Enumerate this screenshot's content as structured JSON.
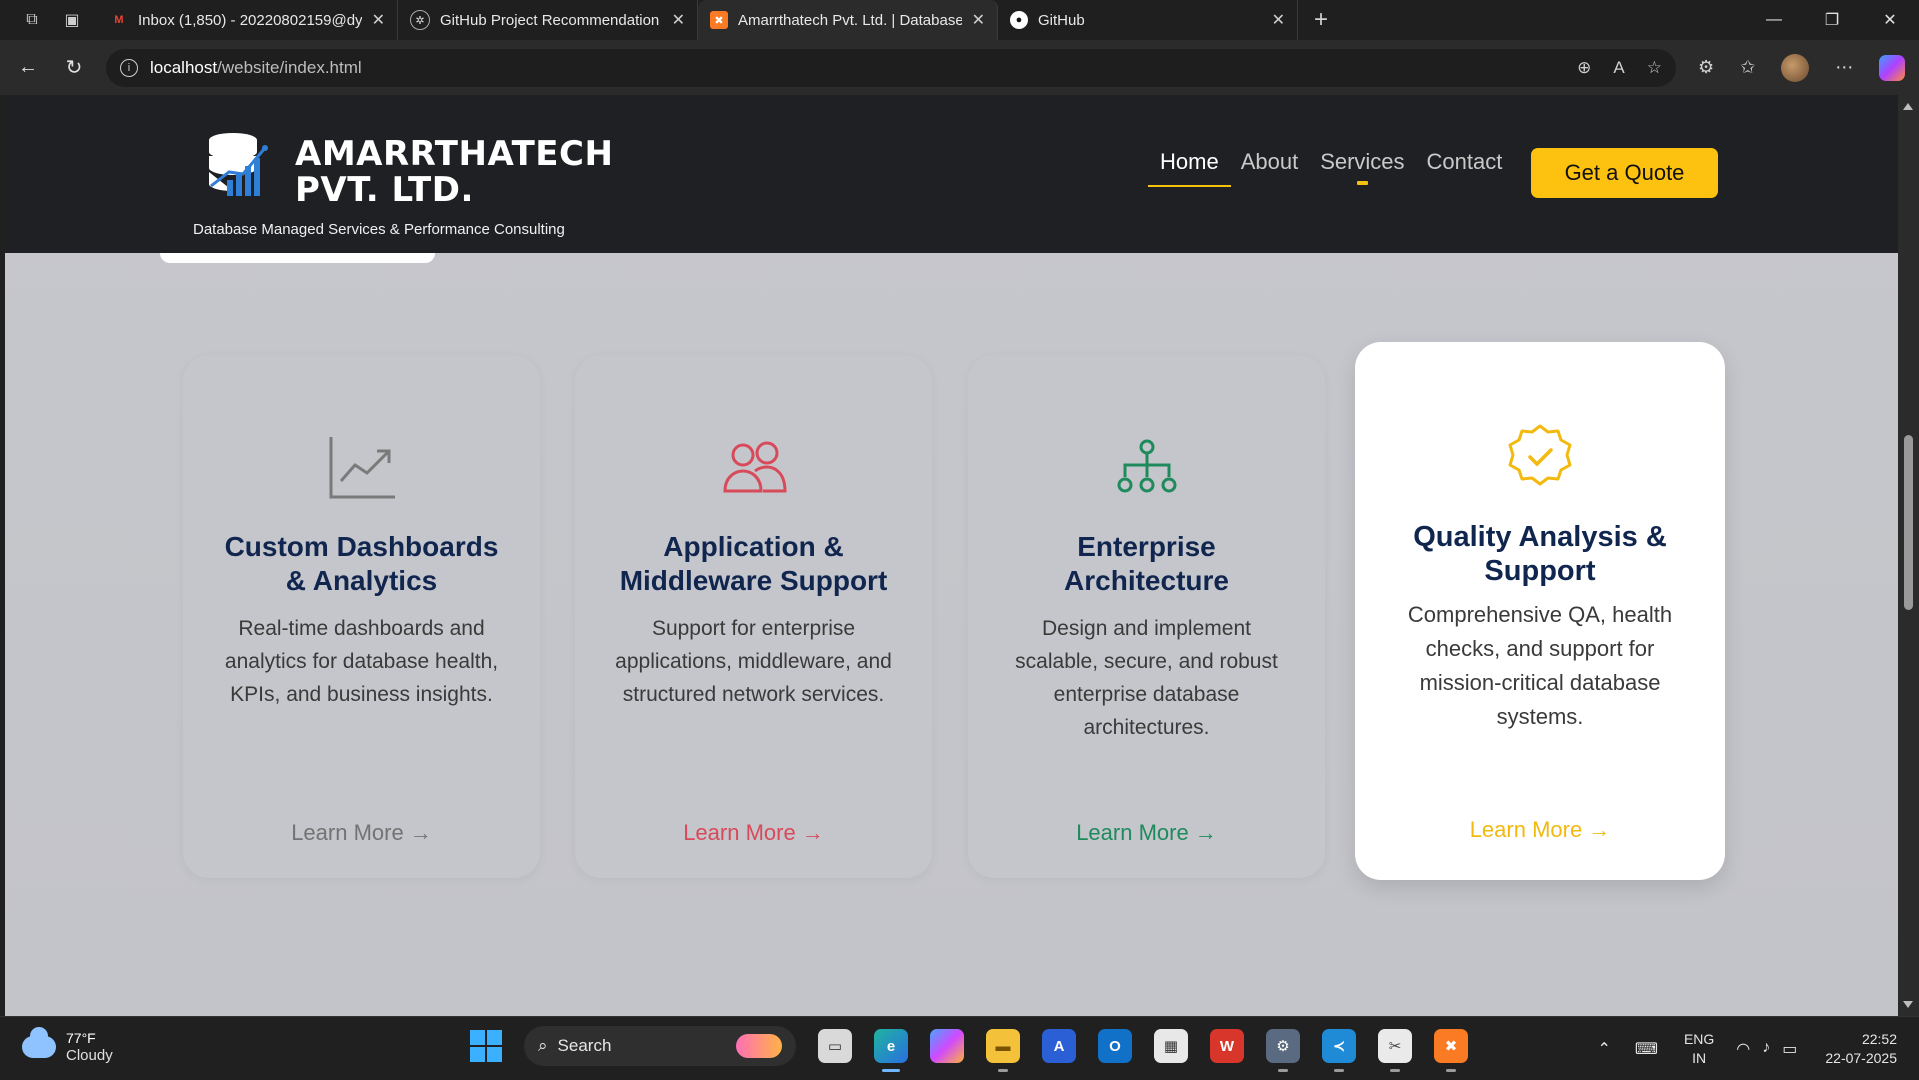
{
  "browser": {
    "tabs": [
      {
        "title": "Inbox (1,850) - 20220802159@dy",
        "icon": "gmail-icon",
        "active": false
      },
      {
        "title": "GitHub Project Recommendation",
        "icon": "chatgpt-icon",
        "active": false
      },
      {
        "title": "Amarrthatech Pvt. Ltd. | Database",
        "icon": "xampp-icon",
        "active": true
      },
      {
        "title": "GitHub",
        "icon": "github-icon",
        "active": false
      }
    ],
    "url_host": "localhost",
    "url_path": "/website/index.html"
  },
  "site": {
    "brand_line1": "AMARRTHATECH",
    "brand_line2": "PVT. LTD.",
    "tagline": "Database Managed Services & Performance Consulting",
    "nav": [
      "Home",
      "About",
      "Services",
      "Contact"
    ],
    "nav_active": "Home",
    "cta": "Get a Quote",
    "accent": "#fdc20f",
    "heading_color": "#10264f"
  },
  "cards": [
    {
      "icon": "line-chart-icon",
      "color": "#7a7a7a",
      "title": "Custom Dashboards & Analytics",
      "description": "Real-time dashboards and analytics for database health, KPIs, and business insights.",
      "link": "Learn More →"
    },
    {
      "icon": "users-icon",
      "color": "#d84a5a",
      "title": "Application & Middleware Support",
      "description": "Support for enterprise applications, middleware, and structured network services.",
      "link": "Learn More →"
    },
    {
      "icon": "sitemap-icon",
      "color": "#1f8a5c",
      "title": "Enterprise Architecture",
      "description": "Design and implement scalable, secure, and robust enterprise database architectures.",
      "link": "Learn More →"
    },
    {
      "icon": "badge-check-icon",
      "color": "#f2b90f",
      "title": "Quality Analysis & Support",
      "description": "Comprehensive QA, health checks, and support for mission-critical database systems.",
      "link": "Learn More →"
    }
  ],
  "taskbar": {
    "temperature": "77°F",
    "condition": "Cloudy",
    "search_placeholder": "Search",
    "lang1": "ENG",
    "lang2": "IN",
    "time": "22:52",
    "date": "22-07-2025"
  }
}
